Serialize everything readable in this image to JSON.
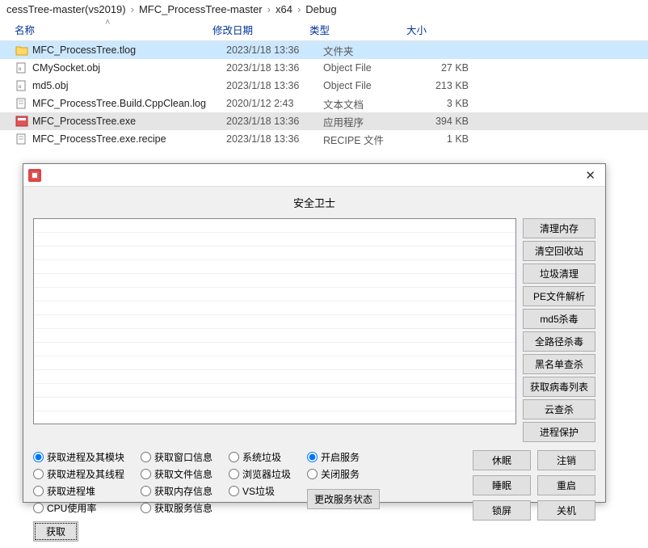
{
  "breadcrumb": {
    "parts": [
      "cessTree-master(vs2019)",
      "MFC_ProcessTree-master",
      "x64",
      "Debug"
    ]
  },
  "columns": {
    "name": "名称",
    "date": "修改日期",
    "type": "类型",
    "size": "大小"
  },
  "files": [
    {
      "name": "MFC_ProcessTree.tlog",
      "date": "2023/1/18 13:36",
      "type": "文件夹",
      "size": "",
      "sel": true,
      "icon": "folder"
    },
    {
      "name": "CMySocket.obj",
      "date": "2023/1/18 13:36",
      "type": "Object File",
      "size": "27 KB",
      "icon": "obj"
    },
    {
      "name": "md5.obj",
      "date": "2023/1/18 13:36",
      "type": "Object File",
      "size": "213 KB",
      "icon": "obj"
    },
    {
      "name": "MFC_ProcessTree.Build.CppClean.log",
      "date": "2020/1/12 2:43",
      "type": "文本文档",
      "size": "3 KB",
      "icon": "txt"
    },
    {
      "name": "MFC_ProcessTree.exe",
      "date": "2023/1/18 13:36",
      "type": "应用程序",
      "size": "394 KB",
      "hov": true,
      "icon": "exe"
    },
    {
      "name": "MFC_ProcessTree.exe.recipe",
      "date": "2023/1/18 13:36",
      "type": "RECIPE 文件",
      "size": "1 KB",
      "icon": "txt"
    }
  ],
  "dialog": {
    "title": "安全卫士",
    "side_buttons": [
      "清理内存",
      "清空回收站",
      "垃圾清理",
      "PE文件解析",
      "md5杀毒",
      "全路径杀毒",
      "黑名单查杀",
      "获取病毒列表",
      "云查杀",
      "进程保护"
    ],
    "radios_col1": [
      "获取进程及其模块",
      "获取进程及其线程",
      "获取进程堆",
      "CPU使用率"
    ],
    "radios_col2": [
      "获取窗口信息",
      "获取文件信息",
      "获取内存信息",
      "获取服务信息"
    ],
    "radios_col3": [
      "系统垃圾",
      "浏览器垃圾",
      "VS垃圾"
    ],
    "radios_svc": [
      "开启服务",
      "关闭服务"
    ],
    "fetch_btn": "获取",
    "svc_btn": "更改服务状态",
    "power": [
      "休眠",
      "注销",
      "睡眠",
      "重启",
      "锁屏",
      "关机"
    ]
  }
}
